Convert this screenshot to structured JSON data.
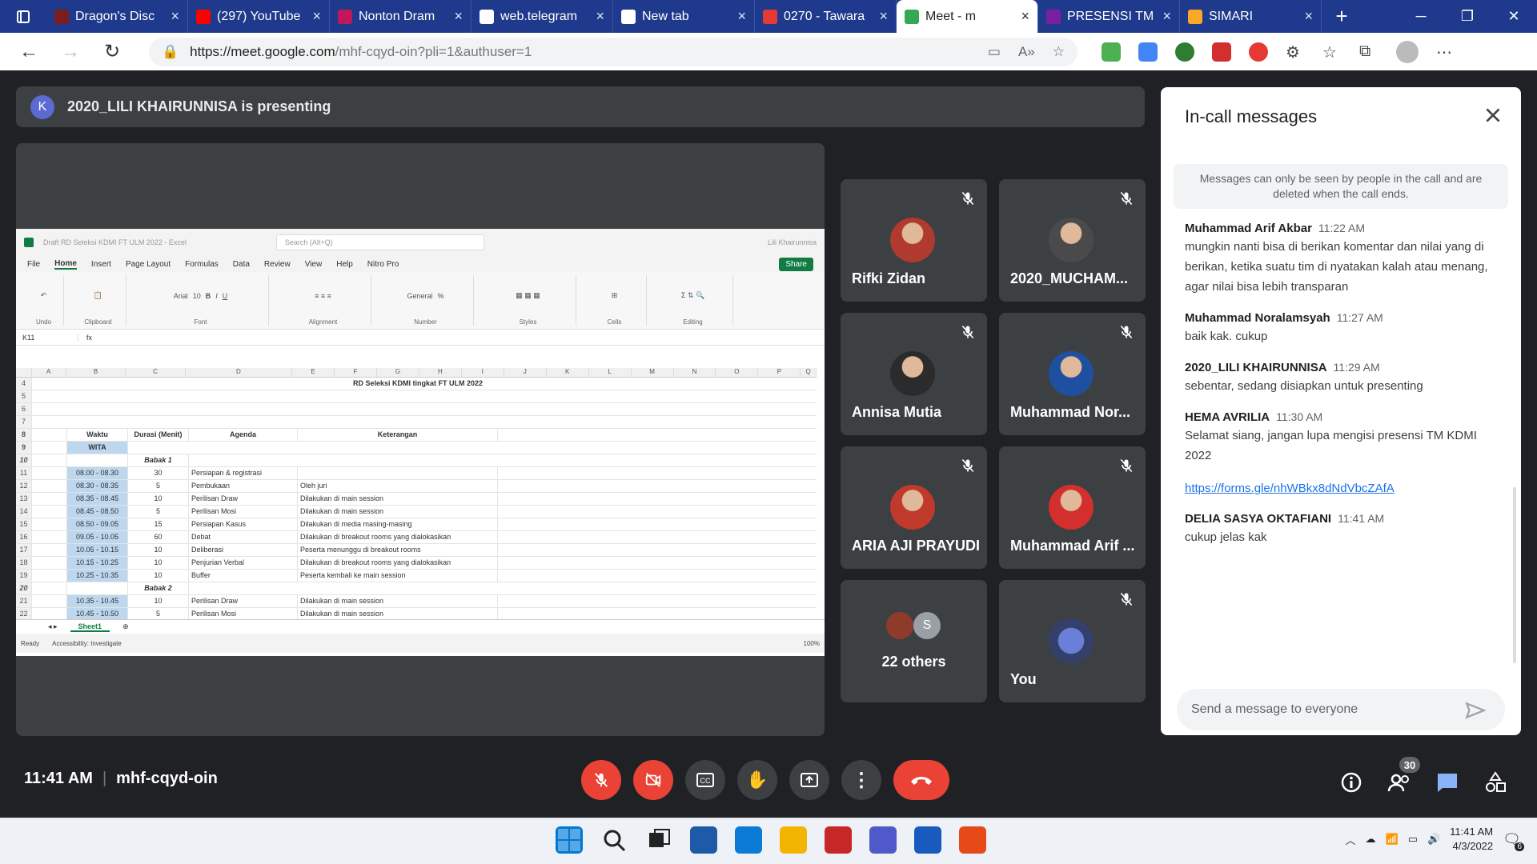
{
  "browser": {
    "tabs": [
      {
        "label": "Dragon's Disc",
        "color": "#7a1d1d"
      },
      {
        "label": "(297) YouTube",
        "color": "#ff0000"
      },
      {
        "label": "Nonton Dram",
        "color": "#c2185b"
      },
      {
        "label": "web.telegram",
        "color": "#ffffff"
      },
      {
        "label": "New tab",
        "color": "#ffffff"
      },
      {
        "label": "0270 - Tawara",
        "color": "#e53935"
      },
      {
        "label": "Meet - m",
        "color": "#34a853",
        "active": true
      },
      {
        "label": "PRESENSI TM",
        "color": "#7b1fa2"
      },
      {
        "label": "SIMARI",
        "color": "#f9a825"
      }
    ],
    "url_host": "https://meet.google.com",
    "url_path": "/mhf-cqyd-oin?pli=1&authuser=1"
  },
  "meet": {
    "presenting": "2020_LILI KHAIRUNNISA is presenting",
    "presenter_initial": "K",
    "time": "11:41 AM",
    "meeting_code": "mhf-cqyd-oin",
    "participant_count": "30",
    "participants": [
      {
        "name": "Rifki Zidan",
        "photo": "#b03a2e"
      },
      {
        "name": "2020_MUCHAM...",
        "photo": "#4a4a4a"
      },
      {
        "name": "Annisa Mutia",
        "photo": "#2b2b2b"
      },
      {
        "name": "Muhammad Nor...",
        "photo": "#1f4fa0"
      },
      {
        "name": "ARIA AJI PRAYUDI",
        "photo": "#c0392b"
      },
      {
        "name": "Muhammad Arif ...",
        "photo": "#d32f2f"
      }
    ],
    "others_label": "22 others",
    "others_initial": "S",
    "you_label": "You"
  },
  "excel": {
    "title": "Draft RD Seleksi KDMI FT ULM 2022 - Excel",
    "search": "Search (Alt+Q)",
    "user": "Lili Khairunnisa",
    "menus": [
      "File",
      "Home",
      "Insert",
      "Page Layout",
      "Formulas",
      "Data",
      "Review",
      "View",
      "Help",
      "Nitro Pro"
    ],
    "share": "Share",
    "font": "Arial",
    "font_size": "10",
    "number_format": "General",
    "groups": [
      "Clipboard",
      "Font",
      "Alignment",
      "Number",
      "Styles",
      "Cells",
      "Editing"
    ],
    "cell_ref": "K11",
    "columns": [
      "A",
      "B",
      "C",
      "D",
      "E",
      "F",
      "G",
      "H",
      "I",
      "J",
      "K",
      "L",
      "M",
      "N",
      "O",
      "P",
      "Q"
    ],
    "sheet_title": "RD Seleksi KDMI tingkat FT ULM 2022",
    "headers": {
      "waktu": "Waktu",
      "durasi": "Durasi (Menit)",
      "agenda": "Agenda",
      "ket": "Keterangan",
      "wita": "WITA"
    },
    "babak1": "Babak 1",
    "babak2": "Babak 2",
    "rows": [
      {
        "n": "11",
        "time": "08.00 - 08.30",
        "dur": "30",
        "agenda": "Persiapan & registrasi",
        "ket": ""
      },
      {
        "n": "12",
        "time": "08.30 - 08.35",
        "dur": "5",
        "agenda": "Pembukaan",
        "ket": "Oleh juri"
      },
      {
        "n": "13",
        "time": "08.35 - 08.45",
        "dur": "10",
        "agenda": "Perilisan Draw",
        "ket": "Dilakukan di main session"
      },
      {
        "n": "14",
        "time": "08.45 - 08.50",
        "dur": "5",
        "agenda": "Perilisan Mosi",
        "ket": "Dilakukan di main session"
      },
      {
        "n": "15",
        "time": "08.50 - 09.05",
        "dur": "15",
        "agenda": "Persiapan Kasus",
        "ket": "Dilakukan di media masing-masing"
      },
      {
        "n": "16",
        "time": "09.05 - 10.05",
        "dur": "60",
        "agenda": "Debat",
        "ket": "Dilakukan di breakout rooms yang dialokasikan"
      },
      {
        "n": "17",
        "time": "10.05 - 10.15",
        "dur": "10",
        "agenda": "Deliberasi",
        "ket": "Peserta menunggu di breakout rooms"
      },
      {
        "n": "18",
        "time": "10.15 - 10.25",
        "dur": "10",
        "agenda": "Penjurian Verbal",
        "ket": "Dilakukan di breakout rooms yang dialokasikan"
      },
      {
        "n": "19",
        "time": "10.25 - 10.35",
        "dur": "10",
        "agenda": "Buffer",
        "ket": "Peserta kembali ke main session"
      }
    ],
    "rows2": [
      {
        "n": "21",
        "time": "10.35 - 10.45",
        "dur": "10",
        "agenda": "Perilisan Draw",
        "ket": "Dilakukan di main session"
      },
      {
        "n": "22",
        "time": "10.45 - 10.50",
        "dur": "5",
        "agenda": "Perilisan Mosi",
        "ket": "Dilakukan di main session"
      }
    ],
    "sheet_tab": "Sheet1",
    "status_ready": "Ready",
    "status_access": "Accessibility: Investigate",
    "zoom": "100%"
  },
  "chat": {
    "title": "In-call messages",
    "info": "Messages can only be seen by people in the call and are deleted when the call ends.",
    "messages": [
      {
        "who": "Muhammad Arif Akbar",
        "time": "11:22 AM",
        "text": "mungkin nanti bisa di berikan komentar dan nilai yang di berikan, ketika suatu tim di nyatakan kalah atau menang, agar nilai bisa lebih transparan"
      },
      {
        "who": "Muhammad Noralamsyah",
        "time": "11:27 AM",
        "text": "baik kak. cukup"
      },
      {
        "who": "2020_LILI KHAIRUNNISA",
        "time": "11:29 AM",
        "text": "sebentar, sedang disiapkan untuk presenting"
      },
      {
        "who": "HEMA AVRILIA",
        "time": "11:30 AM",
        "text": "Selamat siang, jangan lupa mengisi presensi TM KDMI 2022",
        "link": "https://forms.gle/nhWBkx8dNdVbcZAfA"
      },
      {
        "who": "DELIA SASYA OKTAFIANI",
        "time": "11:41 AM",
        "text": "cukup jelas kak"
      }
    ],
    "placeholder": "Send a message to everyone"
  },
  "taskbar": {
    "time": "11:41 AM",
    "date": "4/3/2022",
    "notif": "6",
    "apps": [
      "start-icon",
      "search-icon",
      "taskview-icon",
      "widgets-icon",
      "edge-icon",
      "explorer-icon",
      "app-icon",
      "teams-icon",
      "word-icon",
      "app2-icon"
    ]
  }
}
